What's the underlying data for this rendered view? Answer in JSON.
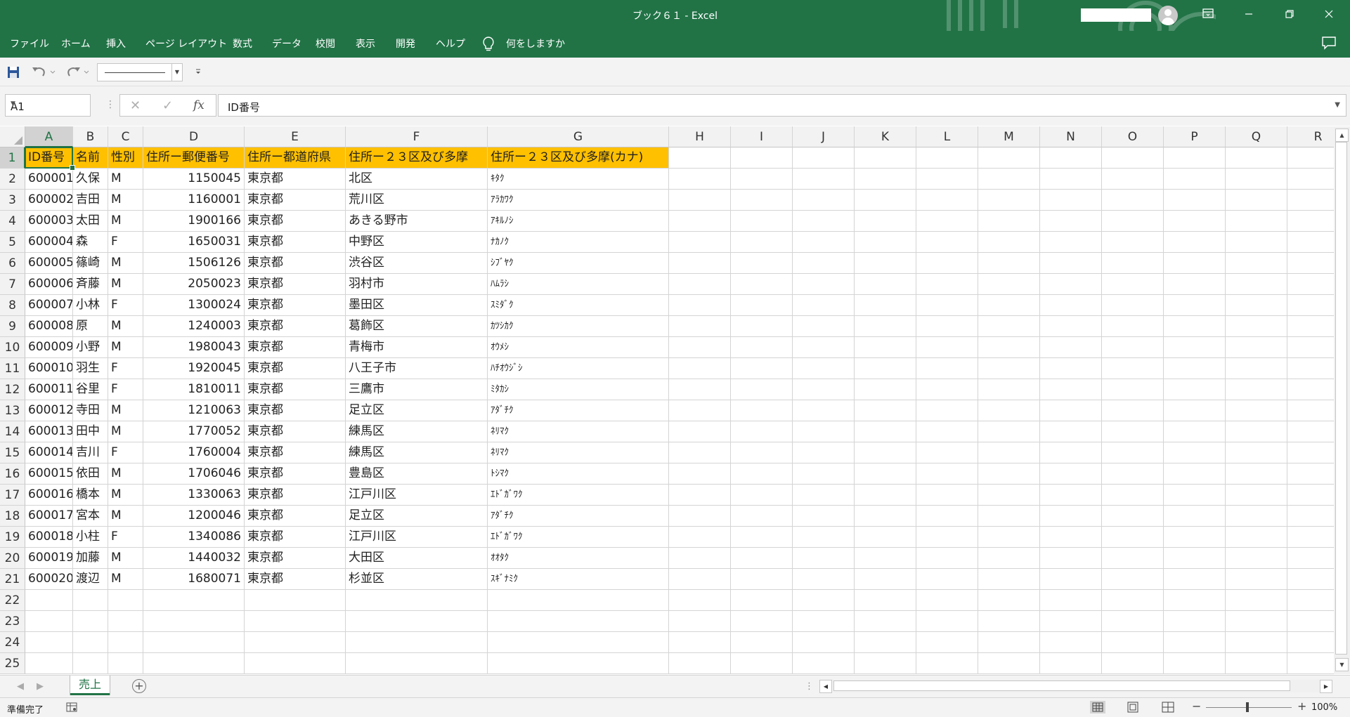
{
  "app": {
    "title": "ブック６１ - Excel",
    "window_controls": [
      "ribbon-display-icon",
      "minimize-icon",
      "restore-icon",
      "close-icon"
    ]
  },
  "menu": {
    "items": [
      "ファイル",
      "ホーム",
      "挿入",
      "ページ レイアウト",
      "数式",
      "データ",
      "校閲",
      "表示",
      "開発",
      "ヘルプ"
    ],
    "tell_me": "何をしますか"
  },
  "formula_bar": {
    "name_box": "A1",
    "cancel": "✕",
    "enter": "✓",
    "fx": "fx",
    "content": "ID番号"
  },
  "sheet": {
    "columns": [
      "A",
      "B",
      "C",
      "D",
      "E",
      "F",
      "G",
      "H",
      "I",
      "J",
      "K",
      "L",
      "M",
      "N",
      "O",
      "P",
      "Q",
      "R"
    ],
    "row_numbers": [
      "1",
      "2",
      "3",
      "4",
      "5",
      "6",
      "7",
      "8",
      "9",
      "10",
      "11",
      "12",
      "13",
      "14",
      "15",
      "16",
      "17",
      "18",
      "19",
      "20",
      "21",
      "22",
      "23",
      "24",
      "25"
    ],
    "header_row": [
      "ID番号",
      "名前",
      "性別",
      "住所ー郵便番号",
      "住所ー都道府県",
      "住所ー２３区及び多摩",
      "住所ー２３区及び多摩(カナ)"
    ],
    "header_fill": "#ffc000",
    "rows": [
      [
        "600001",
        "久保",
        "M",
        "1150045",
        "東京都",
        "北区",
        "ｷﾀｸ"
      ],
      [
        "600002",
        "吉田",
        "M",
        "1160001",
        "東京都",
        "荒川区",
        "ｱﾗｶﾜｸ"
      ],
      [
        "600003",
        "太田",
        "M",
        "1900166",
        "東京都",
        "あきる野市",
        "ｱｷﾙﾉｼ"
      ],
      [
        "600004",
        "森",
        "F",
        "1650031",
        "東京都",
        "中野区",
        "ﾅｶﾉｸ"
      ],
      [
        "600005",
        "篠崎",
        "M",
        "1506126",
        "東京都",
        "渋谷区",
        "ｼﾌﾞﾔｸ"
      ],
      [
        "600006",
        "斉藤",
        "M",
        "2050023",
        "東京都",
        "羽村市",
        "ﾊﾑﾗｼ"
      ],
      [
        "600007",
        "小林",
        "F",
        "1300024",
        "東京都",
        "墨田区",
        "ｽﾐﾀﾞｸ"
      ],
      [
        "600008",
        "原",
        "M",
        "1240003",
        "東京都",
        "葛飾区",
        "ｶﾂｼｶｸ"
      ],
      [
        "600009",
        "小野",
        "M",
        "1980043",
        "東京都",
        "青梅市",
        "ｵｳﾒｼ"
      ],
      [
        "600010",
        "羽生",
        "F",
        "1920045",
        "東京都",
        "八王子市",
        "ﾊﾁｵｳｼﾞｼ"
      ],
      [
        "600011",
        "谷里",
        "F",
        "1810011",
        "東京都",
        "三鷹市",
        "ﾐﾀｶｼ"
      ],
      [
        "600012",
        "寺田",
        "M",
        "1210063",
        "東京都",
        "足立区",
        "ｱﾀﾞﾁｸ"
      ],
      [
        "600013",
        "田中",
        "M",
        "1770052",
        "東京都",
        "練馬区",
        "ﾈﾘﾏｸ"
      ],
      [
        "600014",
        "吉川",
        "F",
        "1760004",
        "東京都",
        "練馬区",
        "ﾈﾘﾏｸ"
      ],
      [
        "600015",
        "依田",
        "M",
        "1706046",
        "東京都",
        "豊島区",
        "ﾄｼﾏｸ"
      ],
      [
        "600016",
        "橋本",
        "M",
        "1330063",
        "東京都",
        "江戸川区",
        "ｴﾄﾞｶﾞﾜｸ"
      ],
      [
        "600017",
        "宮本",
        "M",
        "1200046",
        "東京都",
        "足立区",
        "ｱﾀﾞﾁｸ"
      ],
      [
        "600018",
        "小柱",
        "F",
        "1340086",
        "東京都",
        "江戸川区",
        "ｴﾄﾞｶﾞﾜｸ"
      ],
      [
        "600019",
        "加藤",
        "M",
        "1440032",
        "東京都",
        "大田区",
        "ｵｵﾀｸ"
      ],
      [
        "600020",
        "渡辺",
        "M",
        "1680071",
        "東京都",
        "杉並区",
        "ｽｷﾞﾅﾐｸ"
      ]
    ]
  },
  "sheet_tabs": {
    "active": "売上",
    "add": "+"
  },
  "status": {
    "ready": "準備完了",
    "zoom_minus": "−",
    "zoom_plus": "+",
    "zoom": "100%"
  },
  "colors": {
    "accent": "#217346",
    "header_fill": "#ffc000"
  }
}
